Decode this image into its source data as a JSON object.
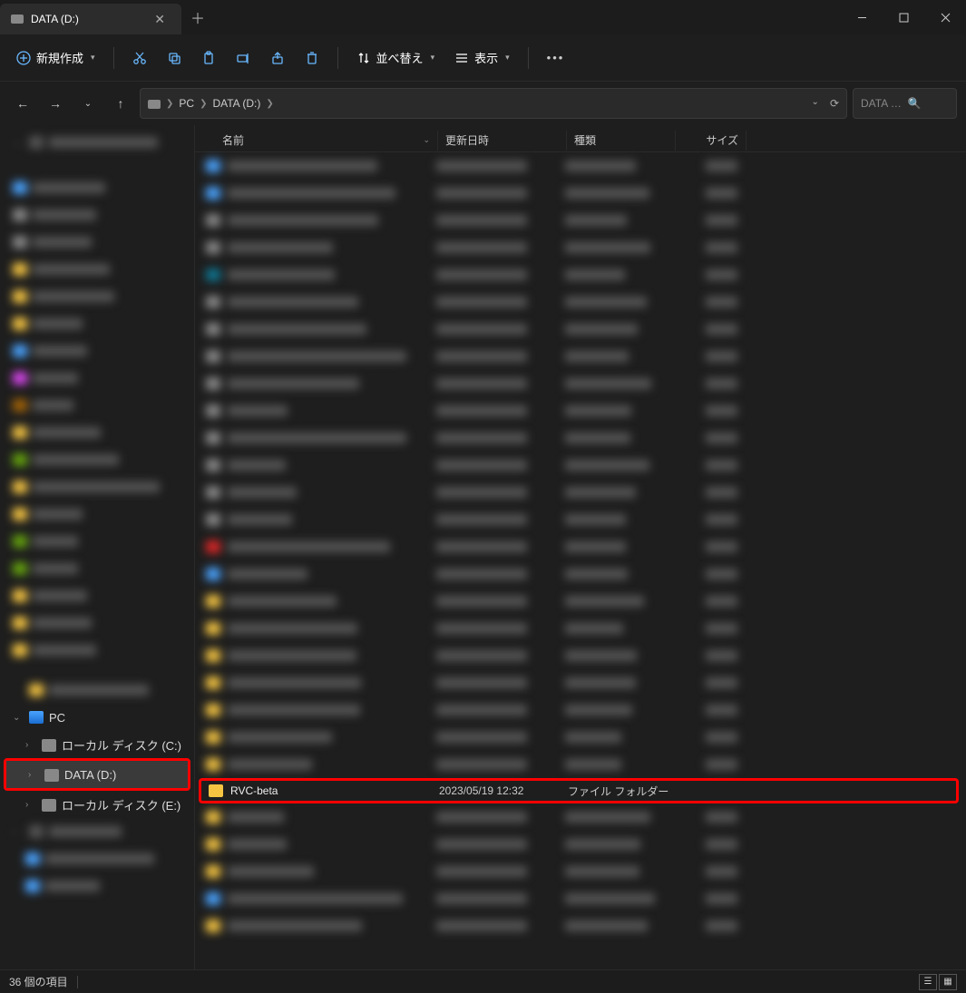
{
  "window": {
    "title": "DATA (D:)"
  },
  "toolbar": {
    "new": "新規作成",
    "sort": "並べ替え",
    "view": "表示"
  },
  "breadcrumb": {
    "pc": "PC",
    "drive": "DATA (D:)"
  },
  "search": {
    "placeholder": "DATA (D:)..."
  },
  "columns": {
    "name": "名前",
    "date": "更新日時",
    "type": "種類",
    "size": "サイズ"
  },
  "sidebar": {
    "pc": "PC",
    "drive_c": "ローカル ディスク (C:)",
    "drive_d": "DATA (D:)",
    "drive_e": "ローカル ディスク (E:)"
  },
  "highlighted_row": {
    "name": "RVC-beta",
    "date": "2023/05/19 12:32",
    "type": "ファイル フォルダー",
    "size": ""
  },
  "status": {
    "count": "36 個の項目"
  }
}
